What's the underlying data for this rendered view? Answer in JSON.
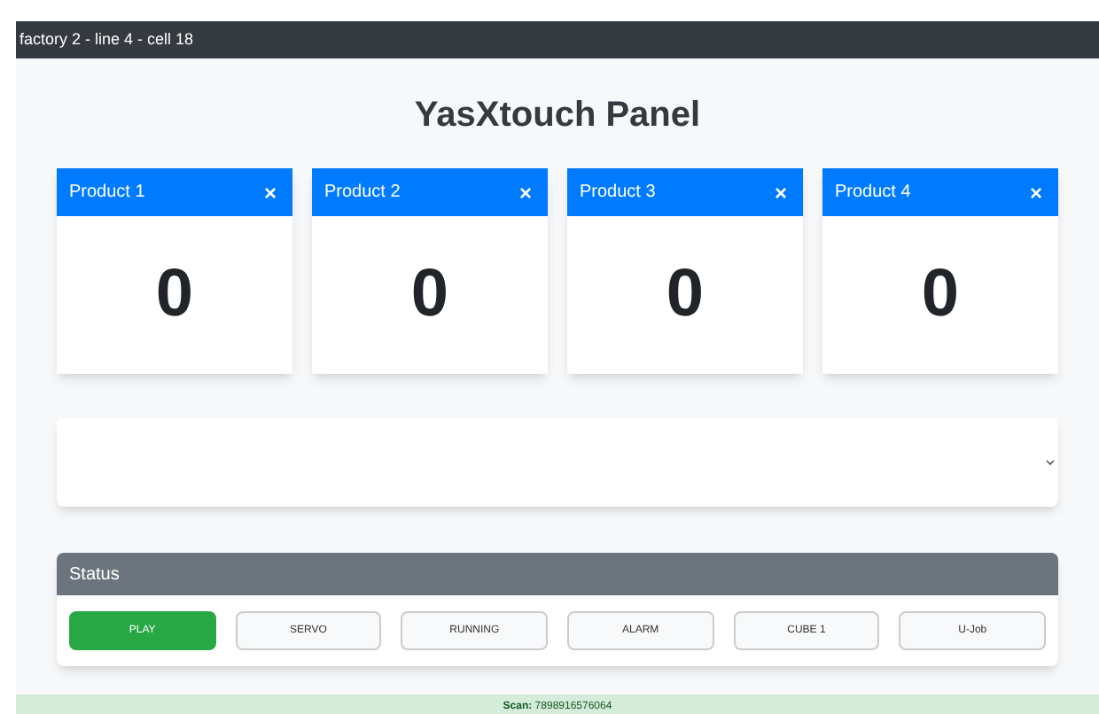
{
  "top_bar": {
    "title": "factory 2 - line 4 - cell 18"
  },
  "heading": "YasXtouch Panel",
  "products": [
    {
      "title": "Product 1",
      "close": "×",
      "count": "0"
    },
    {
      "title": "Product 2",
      "close": "×",
      "count": "0"
    },
    {
      "title": "Product 3",
      "close": "×",
      "count": "0"
    },
    {
      "title": "Product 4",
      "close": "×",
      "count": "0"
    }
  ],
  "status": {
    "title": "Status",
    "indicators": [
      {
        "label": "PLAY",
        "on": true
      },
      {
        "label": "SERVO",
        "on": false
      },
      {
        "label": "RUNNING",
        "on": false
      },
      {
        "label": "ALARM",
        "on": false
      },
      {
        "label": "CUBE 1",
        "on": false
      },
      {
        "label": "U-Job",
        "on": false
      }
    ]
  },
  "footer": {
    "scan": "**Scan:** 7898916576064"
  }
}
